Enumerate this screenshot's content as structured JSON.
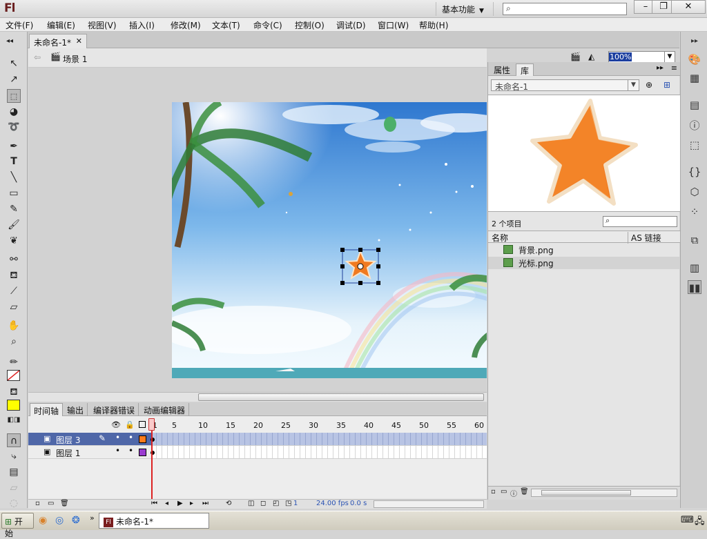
{
  "app": {
    "logo": "Fl",
    "workspace": "基本功能"
  },
  "menu": [
    "文件(F)",
    "编辑(E)",
    "视图(V)",
    "插入(I)",
    "修改(M)",
    "文本(T)",
    "命令(C)",
    "控制(O)",
    "调试(D)",
    "窗口(W)",
    "帮助(H)"
  ],
  "document": {
    "tab_title": "未命名-1*",
    "scene": "场景 1",
    "zoom": "100%"
  },
  "timeline": {
    "tabs": [
      "时间轴",
      "输出",
      "编译器错误",
      "动画编辑器"
    ],
    "ticks": [
      "1",
      "5",
      "10",
      "15",
      "20",
      "25",
      "30",
      "35",
      "40",
      "45",
      "50",
      "55",
      "60"
    ],
    "layers": [
      {
        "name": "图层 3",
        "color": "#ff7b1c",
        "selected": true
      },
      {
        "name": "图层 1",
        "color": "#9a3bd0",
        "selected": false
      }
    ],
    "status": {
      "frame": "1",
      "fps": "24.00 fps",
      "time": "0.0 s"
    }
  },
  "library": {
    "tabs": [
      "属性",
      "库"
    ],
    "doc_select": "未命名-1",
    "item_count": "2 个项目",
    "columns": [
      "名称",
      "AS 链接"
    ],
    "items": [
      "背景.png",
      "光标.png"
    ]
  },
  "taskbar": {
    "start": "开始",
    "task": "未命名-1*"
  },
  "colors": {
    "stroke": "#000000",
    "fill": "#ffff00",
    "selected_layer": "#4f67a8"
  }
}
